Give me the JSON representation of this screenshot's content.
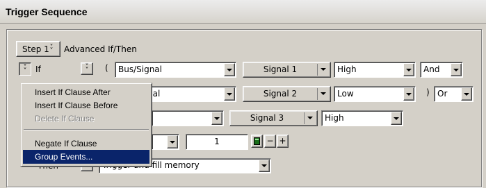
{
  "header": {
    "title": "Trigger Sequence"
  },
  "step": {
    "label": "Step 1",
    "type_label": "Advanced If/Then"
  },
  "row1": {
    "if_label": "If",
    "open_paren": "(",
    "source": "Bus/Signal",
    "signal": "Signal 1",
    "value": "High",
    "logic": "And"
  },
  "row2": {
    "source_partial": "nal",
    "signal": "Signal 2",
    "value": "Low",
    "close_paren": ")",
    "logic": "Or"
  },
  "row3": {
    "signal": "Signal 3",
    "value": "High"
  },
  "row4": {
    "count": "1",
    "minus": "−",
    "plus": "+"
  },
  "row5": {
    "then_label": "Then",
    "action": "Trigger and fill memory"
  },
  "context_menu": {
    "items": [
      {
        "label": "Insert If Clause After",
        "state": "enabled"
      },
      {
        "label": "Insert If Clause Before",
        "state": "enabled"
      },
      {
        "label": "Delete If Clause",
        "state": "disabled"
      },
      {
        "label": "Negate If Clause",
        "state": "enabled"
      },
      {
        "label": "Group Events...",
        "state": "selected"
      }
    ]
  },
  "colors": {
    "face": "#d4d0c8",
    "highlight": "#0a246a"
  }
}
